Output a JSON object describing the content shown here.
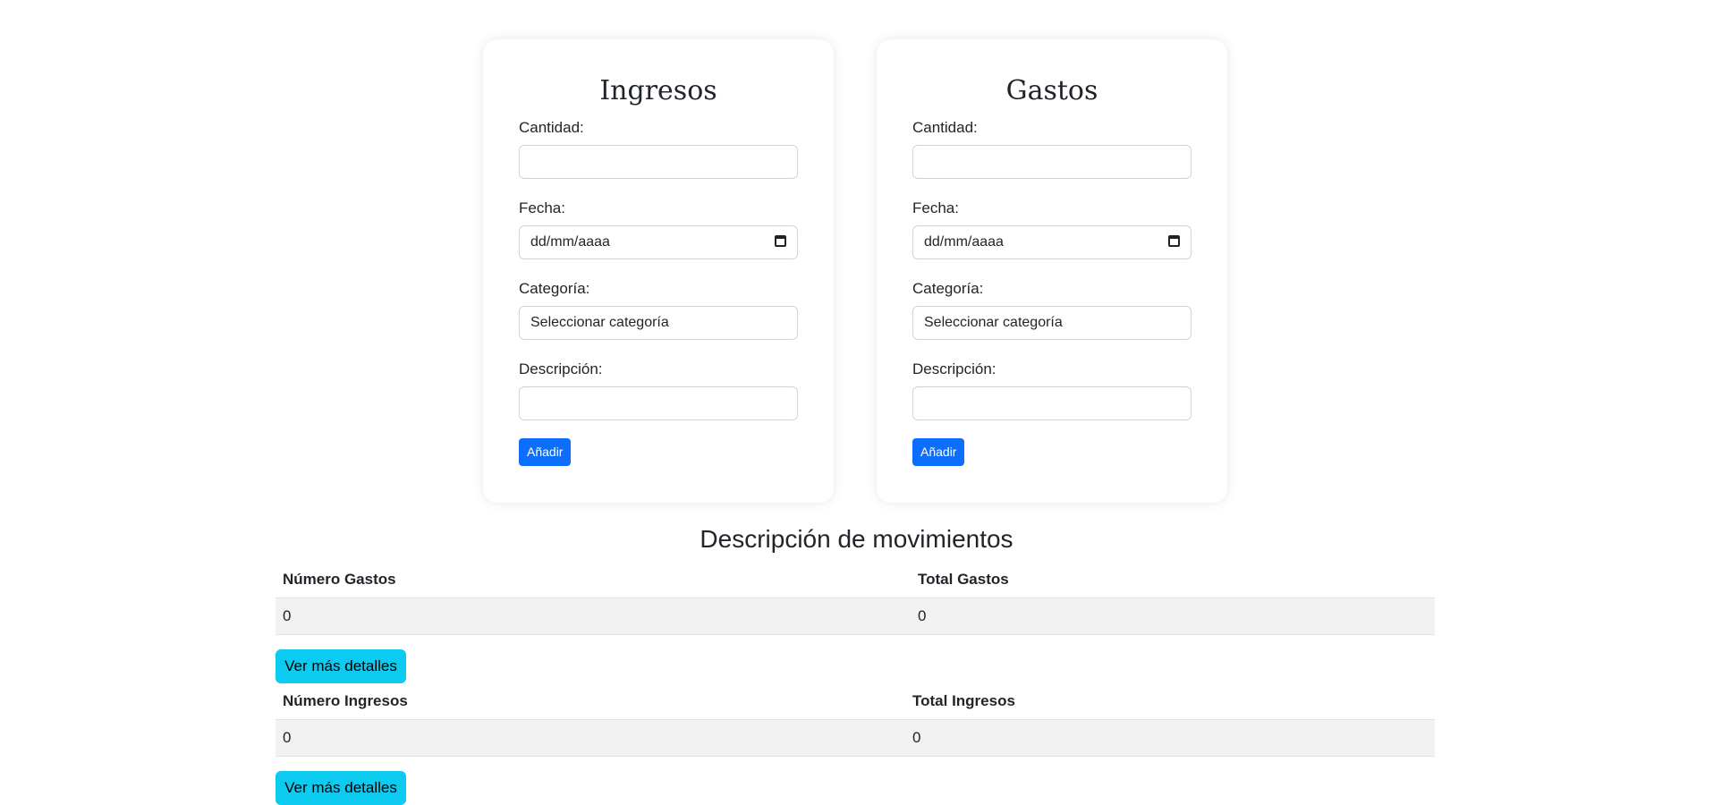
{
  "ingresos_form": {
    "title": "Ingresos",
    "cantidad_label": "Cantidad:",
    "cantidad_value": "",
    "fecha_label": "Fecha:",
    "fecha_placeholder": "dd/mm/aaaa",
    "categoria_label": "Categoría:",
    "categoria_selected": "Seleccionar categoría",
    "descripcion_label": "Descripción:",
    "descripcion_value": "",
    "add_button": "Añadir"
  },
  "gastos_form": {
    "title": "Gastos",
    "cantidad_label": "Cantidad:",
    "cantidad_value": "",
    "fecha_label": "Fecha:",
    "fecha_placeholder": "dd/mm/aaaa",
    "categoria_label": "Categoría:",
    "categoria_selected": "Seleccionar categoría",
    "descripcion_label": "Descripción:",
    "descripcion_value": "",
    "add_button": "Añadir"
  },
  "summary": {
    "title": "Descripción de movimientos",
    "gastos": {
      "headers": [
        "Número Gastos",
        "Total Gastos"
      ],
      "values": [
        "0",
        "0"
      ],
      "details_button": "Ver más detalles"
    },
    "ingresos": {
      "headers": [
        "Número Ingresos",
        "Total Ingresos"
      ],
      "values": [
        "0",
        "0"
      ],
      "details_button": "Ver más detalles"
    }
  },
  "colors": {
    "primary": "#0d6efd",
    "info": "#0dcaf0",
    "row_bg": "#f2f2f2"
  }
}
